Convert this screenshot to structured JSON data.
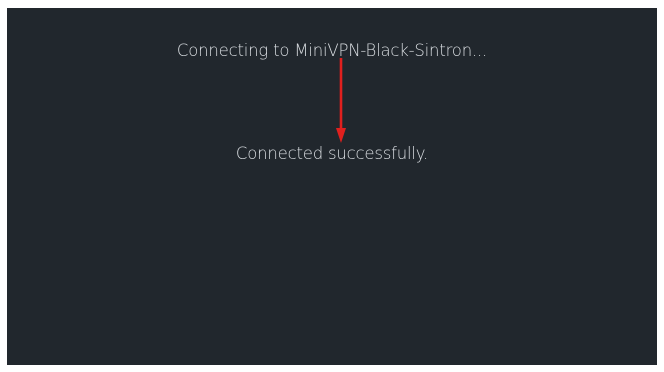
{
  "screen": {
    "connecting_message": "Connecting to MiniVPN-Black-Sintron...",
    "connected_message": "Connected successfully."
  },
  "annotation": {
    "arrow_color": "#e0201e"
  },
  "colors": {
    "background": "#21272d",
    "text": "#d9dde1"
  }
}
